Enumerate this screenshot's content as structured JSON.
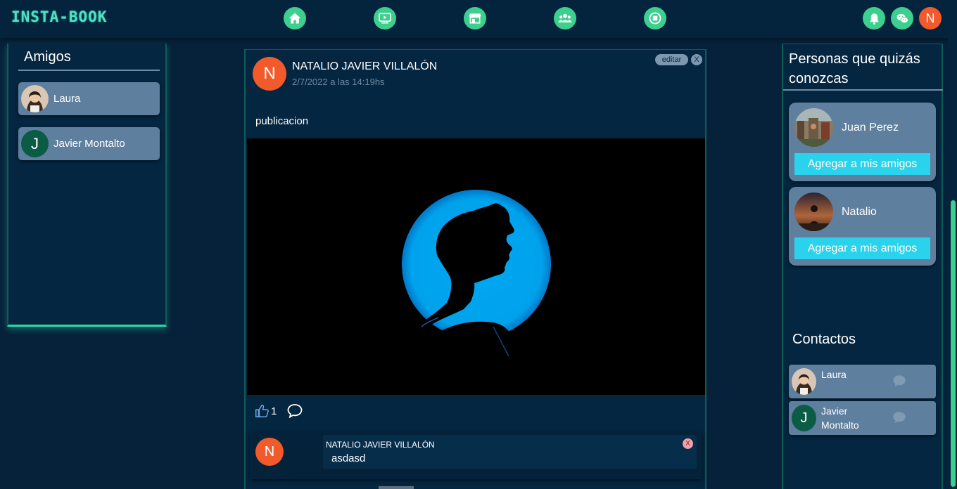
{
  "app": {
    "logo": "INSTA-BOOK"
  },
  "nav": [
    {
      "name": "home-icon"
    },
    {
      "name": "video-icon"
    },
    {
      "name": "store-icon"
    },
    {
      "name": "groups-icon"
    },
    {
      "name": "apps-icon"
    }
  ],
  "header_icons": {
    "bell": "bell-icon",
    "chat": "wechat-icon",
    "user_initial": "N"
  },
  "colors": {
    "accent": "#3ccf8e",
    "background": "#06223a",
    "card": "#5e7f9d",
    "add_button": "#2ad3eb",
    "avatar_orange": "#f25a2c"
  },
  "friends": {
    "title": "Amigos",
    "items": [
      {
        "name": "Laura",
        "avatar": "photo"
      },
      {
        "name": "Javier Montalto",
        "avatar": "J"
      }
    ]
  },
  "post": {
    "avatar_initial": "N",
    "author": "NATALIO JAVIER VILLALÓN",
    "date": "2/7/2022 a las 14:19hs",
    "edit_label": "editar",
    "close_label": "X",
    "text": "publicacion",
    "likes": "1",
    "comment": {
      "avatar_initial": "N",
      "author": "NATALIO JAVIER VILLALÓN",
      "text": "asdasd",
      "delete_label": "X"
    }
  },
  "suggestions": {
    "title": "Personas que quizás conozcas",
    "items": [
      {
        "name": "Juan Perez",
        "button": "Agregar a mis amigos"
      },
      {
        "name": "Natalio",
        "button": "Agregar a mis amigos"
      }
    ]
  },
  "contacts": {
    "title": "Contactos",
    "items": [
      {
        "name": "Laura",
        "avatar": "photo"
      },
      {
        "name_line1": "Javier",
        "name_line2": "Montalto",
        "avatar": "J"
      }
    ]
  }
}
